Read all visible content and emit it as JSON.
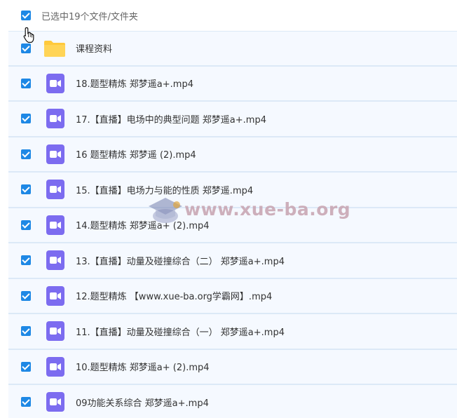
{
  "header": {
    "selection_label": "已选中19个文件/文件夹"
  },
  "folder": {
    "label": "课程资料",
    "icon": "folder-icon",
    "color": "#ffca3a"
  },
  "files": [
    {
      "label": "18.题型精炼 郑梦遥a+.mp4"
    },
    {
      "label": "17.【直播】电场中的典型问题 郑梦遥a+.mp4"
    },
    {
      "label": "16 题型精炼 郑梦遥 (2).mp4"
    },
    {
      "label": "15.【直播】电场力与能的性质 郑梦遥.mp4"
    },
    {
      "label": "14.题型精炼 郑梦遥a+ (2).mp4"
    },
    {
      "label": "13.【直播】动量及碰撞综合（二） 郑梦遥a+.mp4"
    },
    {
      "label": "12.题型精炼 【www.xue-ba.org学霸网】.mp4"
    },
    {
      "label": "11.【直播】动量及碰撞综合（一） 郑梦遥a+.mp4"
    },
    {
      "label": "10.题型精炼 郑梦遥a+ (2).mp4"
    },
    {
      "label": "09功能关系综合 郑梦遥a+.mp4"
    }
  ],
  "watermark": {
    "text": "www.xue-ba.org"
  },
  "colors": {
    "checkbox": "#1e88e5",
    "video_icon": "#7c6cf0",
    "row_background": "#f5f9ff",
    "row_divider": "#dce9f7"
  },
  "icons": {
    "video": "video-camera-icon",
    "cursor": "hand-pointer-icon"
  }
}
